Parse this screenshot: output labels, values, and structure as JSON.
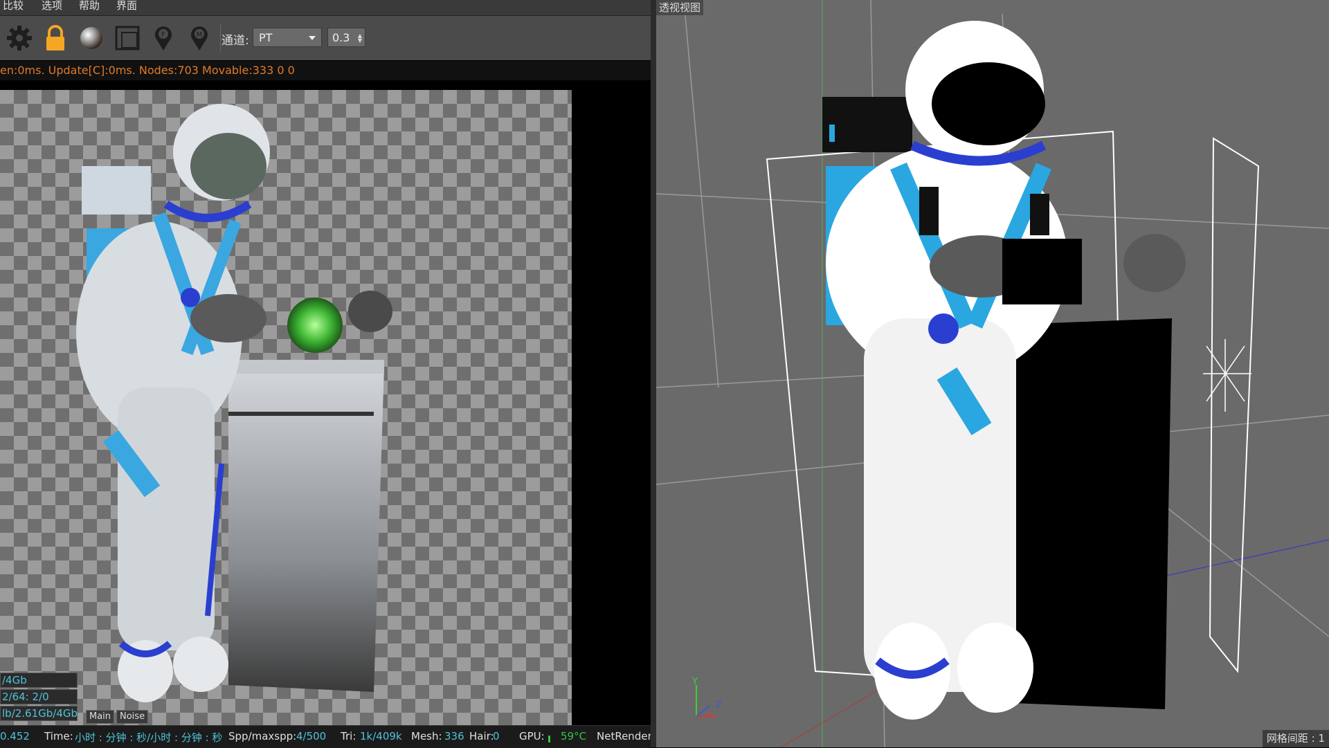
{
  "menu": {
    "items": [
      "比较",
      "选项",
      "帮助",
      "界面"
    ]
  },
  "toolbar": {
    "icons": [
      "gear-icon",
      "lock-icon",
      "material-sphere-icon",
      "region-render-icon",
      "focus-pin-icon",
      "material-pin-icon"
    ],
    "channel_label": "通道:",
    "channel_value": "PT",
    "value_spinner": "0.3"
  },
  "info_line": "en:0ms. Update[C]:0ms. Nodes:703 Movable:333  0 0",
  "memory": {
    "line1": "/4Gb",
    "line2_prefix": "2/64:",
    "line2_value": "2/0",
    "line3": "lb/2.61Gb/4Gb"
  },
  "render_tabs": [
    "Main",
    "Noise"
  ],
  "statusbar": {
    "value": "0.452",
    "time_label": "Time:",
    "time_value": "小时 : 分钟 : 秒/小时 : 分钟 : 秒",
    "spp_label": "Spp/maxspp:",
    "spp_value": "4/500",
    "tri_label": "Tri:",
    "tri_value": "1k/409k",
    "mesh_label": "Mesh:",
    "mesh_value": "336",
    "hair_label": "Hair:",
    "hair_value": "0",
    "gpu_label": "GPU:",
    "gpu_temp": "59°C",
    "netrender": "NetRender"
  },
  "viewport": {
    "label": "透视视图",
    "grid_spacing_label": "网格间距 : 1",
    "axes": {
      "y": "Y",
      "z": "Z",
      "x": "X"
    }
  },
  "colors": {
    "info_text": "#e07b2a",
    "memory_text": "#4fc3d9",
    "status_green": "#37c24a",
    "accent_orange": "#f5a623"
  }
}
